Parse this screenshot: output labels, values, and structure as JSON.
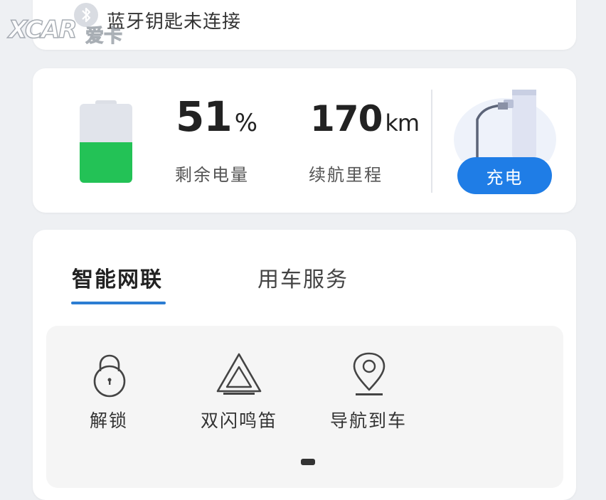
{
  "bluetooth": {
    "status": "蓝牙钥匙未连接",
    "icon": "bluetooth-icon"
  },
  "watermark": {
    "logo": "XCAR",
    "text": "爱卡"
  },
  "battery": {
    "level": 51,
    "level_value": "51",
    "level_unit": "%",
    "level_label": "剩余电量",
    "range_value": "170",
    "range_unit": "km",
    "range_label": "续航里程",
    "fill_color": "#23c256"
  },
  "charge": {
    "button_label": "充电",
    "icon": "charger-icon",
    "button_color": "#1f7de6"
  },
  "tabs": [
    {
      "label": "智能网联",
      "active": true
    },
    {
      "label": "用车服务",
      "active": false
    }
  ],
  "actions": [
    {
      "label": "解锁",
      "icon": "lock-icon"
    },
    {
      "label": "双闪鸣笛",
      "icon": "hazard-triangle-icon"
    },
    {
      "label": "导航到车",
      "icon": "location-pin-icon"
    }
  ]
}
